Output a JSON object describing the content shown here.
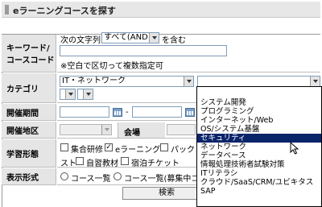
{
  "header": {
    "title": "eラーニングコースを探す"
  },
  "keyword": {
    "label_line1": "キーワード/",
    "label_line2": "コースコード",
    "prefix": "次の文字列",
    "mode_selected": "すべて(AND)",
    "suffix": "を含む",
    "note": "※空白で区切って複数指定可"
  },
  "category": {
    "label": "カテゴリ",
    "primary_selected": "IT・ネットワーク",
    "secondary_selected": "",
    "options": [
      {
        "label": "システム開発",
        "selected": false
      },
      {
        "label": "プログラミング",
        "selected": false
      },
      {
        "label": "インターネット/Web",
        "selected": false
      },
      {
        "label": "OS/システム基盤",
        "selected": false
      },
      {
        "label": "セキュリティ",
        "selected": true
      },
      {
        "label": "ネットワーク",
        "selected": false
      },
      {
        "label": "データベース",
        "selected": false
      },
      {
        "label": "情報処理技術者試験対策",
        "selected": false
      },
      {
        "label": "ITリテラシ",
        "selected": false
      },
      {
        "label": "クラウド/SaaS/CRM/ユビキタス",
        "selected": false
      },
      {
        "label": "SAP",
        "selected": false
      }
    ]
  },
  "period": {
    "label": "開催期間",
    "separator": "-"
  },
  "region": {
    "label": "開催地区",
    "venue_label": "会場"
  },
  "format": {
    "label": "学習形態",
    "options": [
      "集合研修",
      "eラーニング",
      "パック",
      "スト",
      "自習教材",
      "宿泊チケット"
    ],
    "checked": [
      false,
      true,
      false,
      null,
      false,
      false
    ]
  },
  "display": {
    "label": "表示形式",
    "options": [
      "コース一覧",
      "コース一覧(募集中コ"
    ]
  },
  "search_button": {
    "label": "検索"
  }
}
